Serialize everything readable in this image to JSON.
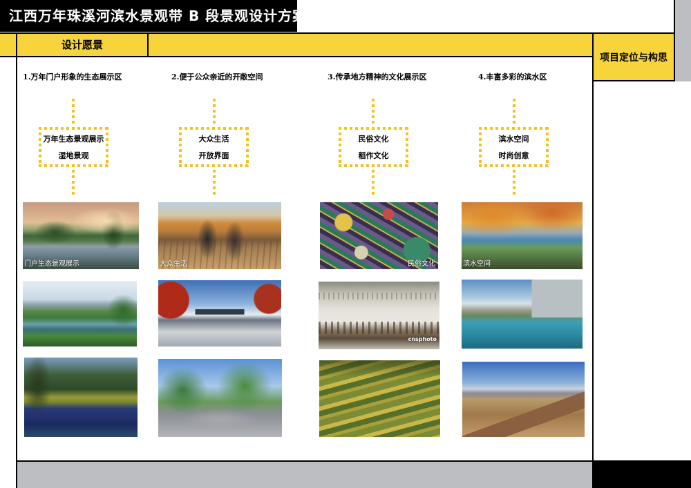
{
  "header": {
    "title": "江西万年珠溪河滨水景观带 B 段景观设计方案"
  },
  "section": {
    "label": "设计愿景"
  },
  "side_panel": {
    "label": "项目定位与构思"
  },
  "columns": [
    {
      "heading": "1.万年门户形象的生态展示区",
      "concept": [
        "万年生态景观展示",
        "湿地景观"
      ],
      "caption": "门户生态景观展示"
    },
    {
      "heading": "2.便于公众亲近的开敞空间",
      "concept": [
        "大众生活",
        "开放界面"
      ],
      "caption": "大众生活"
    },
    {
      "heading": "3.传承地方精神的文化展示区",
      "concept": [
        "民俗文化",
        "稻作文化"
      ],
      "caption": "民俗文化"
    },
    {
      "heading": "4.丰富多彩的滨水区",
      "concept": [
        "滨水空间",
        "时尚创意"
      ],
      "caption": "滨水空间"
    }
  ],
  "watermark": {
    "text": "cnsphoto"
  },
  "colors": {
    "accent_yellow": "#F8D43C",
    "connector_yellow": "#F5C21B",
    "bar_grey": "#BDBEC2",
    "title_bar": "#000000"
  }
}
